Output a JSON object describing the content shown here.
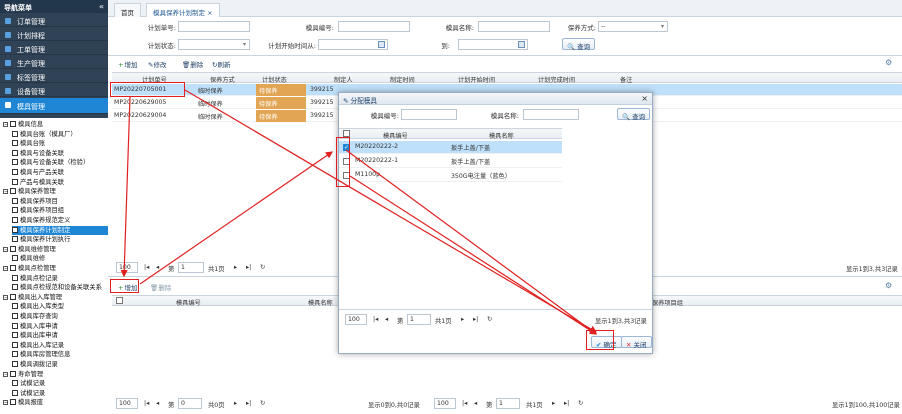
{
  "sidebar": {
    "title": "导航菜单",
    "collapse": "«",
    "modules": [
      {
        "label": "订单管理"
      },
      {
        "label": "计划排程"
      },
      {
        "label": "工单管理"
      },
      {
        "label": "生产管理"
      },
      {
        "label": "标签管理"
      },
      {
        "label": "设备管理"
      },
      {
        "label": "模具管理"
      }
    ],
    "tree": [
      {
        "label": "模具信息",
        "level": 0
      },
      {
        "label": "模具台账（模具厂）",
        "level": 1
      },
      {
        "label": "模具台账",
        "level": 1
      },
      {
        "label": "模具与设备关联",
        "level": 1
      },
      {
        "label": "模具与设备关联（检验）",
        "level": 1
      },
      {
        "label": "模具与产品关联",
        "level": 1
      },
      {
        "label": "产品与模具关联",
        "level": 1
      },
      {
        "label": "模具保养管理",
        "level": 0
      },
      {
        "label": "模具保养项目",
        "level": 1
      },
      {
        "label": "模具保养项目组",
        "level": 1
      },
      {
        "label": "模具保养规范定义",
        "level": 1
      },
      {
        "label": "模具保养计划制定",
        "level": 1
      },
      {
        "label": "模具保养计划执行",
        "level": 1
      },
      {
        "label": "模具维修管理",
        "level": 0
      },
      {
        "label": "模具维修",
        "level": 1
      },
      {
        "label": "模具点检管理",
        "level": 0
      },
      {
        "label": "模具点检记录",
        "level": 1
      },
      {
        "label": "模具点检规范和设备关联关系",
        "level": 1
      },
      {
        "label": "模具出入库管理",
        "level": 0
      },
      {
        "label": "模具出入库类型",
        "level": 1
      },
      {
        "label": "模具库存查询",
        "level": 1
      },
      {
        "label": "模具入库申请",
        "level": 1
      },
      {
        "label": "模具出库申请",
        "level": 1
      },
      {
        "label": "模具出入库记录",
        "level": 1
      },
      {
        "label": "模具库房管理信息",
        "level": 1
      },
      {
        "label": "模具调拨记录",
        "level": 1
      },
      {
        "label": "寿命管理",
        "level": 0
      },
      {
        "label": "试模记录",
        "level": 1
      },
      {
        "label": "试模记录",
        "level": 1
      },
      {
        "label": "模具报废",
        "level": 0
      }
    ]
  },
  "tabs": [
    {
      "label": "首页"
    },
    {
      "label": "模具保养计划制定",
      "close": "×"
    }
  ],
  "filter": {
    "plan_no_label": "计划单号:",
    "mold_no_label": "模具编号:",
    "mold_name_label": "模具名称:",
    "maint_method_label": "保养方式:",
    "maint_method_value": "--",
    "plan_status_label": "计划状态:",
    "plan_start_label": "计划开始时间从:",
    "to_label": "到:",
    "query_button": "查询"
  },
  "toolbar": {
    "add": "增加",
    "edit": "修改",
    "delete": "删除",
    "refresh": "刷新",
    "gear": "⚙"
  },
  "main_grid": {
    "columns": [
      "计划单号",
      "保养方式",
      "计划状态",
      "制定人",
      "制定时间",
      "计划开始时间",
      "计划完成时间",
      "备注"
    ],
    "rows": [
      {
        "plan_no": "MP20220705001",
        "method": "临时保养",
        "status": "待保养",
        "maker": "3992155"
      },
      {
        "plan_no": "MP20220629005",
        "method": "临时保养",
        "status": "待保养",
        "maker": "3992155"
      },
      {
        "plan_no": "MP20220629004",
        "method": "临时保养",
        "status": "待保养",
        "maker": "3992155"
      }
    ],
    "pager": {
      "size": "100",
      "page_prefix": "第",
      "page": "1",
      "page_suffix": "共1页",
      "summary": "显示1到3,共3记录"
    }
  },
  "detail_toolbar": {
    "add": "增加",
    "delete": "删除"
  },
  "detail_grid": {
    "columns": [
      "模具编号",
      "模具名称",
      "保养项目组"
    ],
    "pager_left": {
      "size": "100",
      "page_prefix": "第",
      "page": "0",
      "page_suffix": "共0页",
      "summary": "显示0到0,共0记录"
    },
    "pager_right": {
      "size": "100",
      "page_prefix": "第",
      "page": "1",
      "page_suffix": "共1页",
      "summary": "显示1到100,共100记录"
    }
  },
  "dialog": {
    "title": "分配模具",
    "close": "×",
    "mold_no_label": "模具编号:",
    "mold_name_label": "模具名称:",
    "query_button": "查询",
    "columns": [
      "模具编号",
      "模具名称"
    ],
    "rows": [
      {
        "no": "M20220222-2",
        "name": "扳手上盖/下盖",
        "checked": true
      },
      {
        "no": "M20220222-1",
        "name": "扳手上盖/下盖",
        "checked": false
      },
      {
        "no": "M1100p",
        "name": "350G电注量（蓝色）",
        "checked": false
      }
    ],
    "pager": {
      "size": "100",
      "page_prefix": "第",
      "page": "1",
      "page_suffix": "共1页",
      "summary": "显示1到3,共3记录"
    },
    "confirm_button": "确定",
    "close_button": "关闭"
  },
  "colors": {
    "accent": "#1f86d6",
    "status_pending": "#e1a553",
    "annotation": "#e02020",
    "selected_row": "#bfe0fa"
  }
}
